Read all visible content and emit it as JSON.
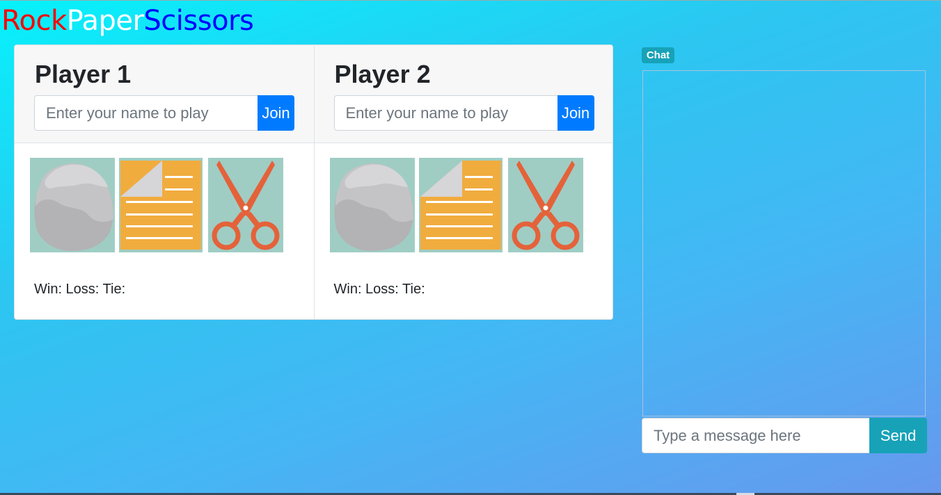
{
  "logo": {
    "rock": "Rock",
    "paper": "Paper",
    "scissors": "Scissors"
  },
  "players": [
    {
      "title": "Player 1",
      "name_placeholder": "Enter your name to play",
      "join_label": "Join",
      "choices": [
        "rock-icon",
        "paper-icon",
        "scissors-icon"
      ],
      "score_text": "Win: Loss: Tie:"
    },
    {
      "title": "Player 2",
      "name_placeholder": "Enter your name to play",
      "join_label": "Join",
      "choices": [
        "rock-icon",
        "paper-icon",
        "scissors-icon"
      ],
      "score_text": "Win: Loss: Tie:"
    }
  ],
  "chat": {
    "badge": "Chat",
    "message_placeholder": "Type a message here",
    "send_label": "Send"
  },
  "colors": {
    "rock": "#ff0000",
    "paper": "#ffffff",
    "scissors": "#0000ff",
    "join_button": "#007bff",
    "send_button": "#17a2b8",
    "chat_badge": "#17a2b8"
  }
}
